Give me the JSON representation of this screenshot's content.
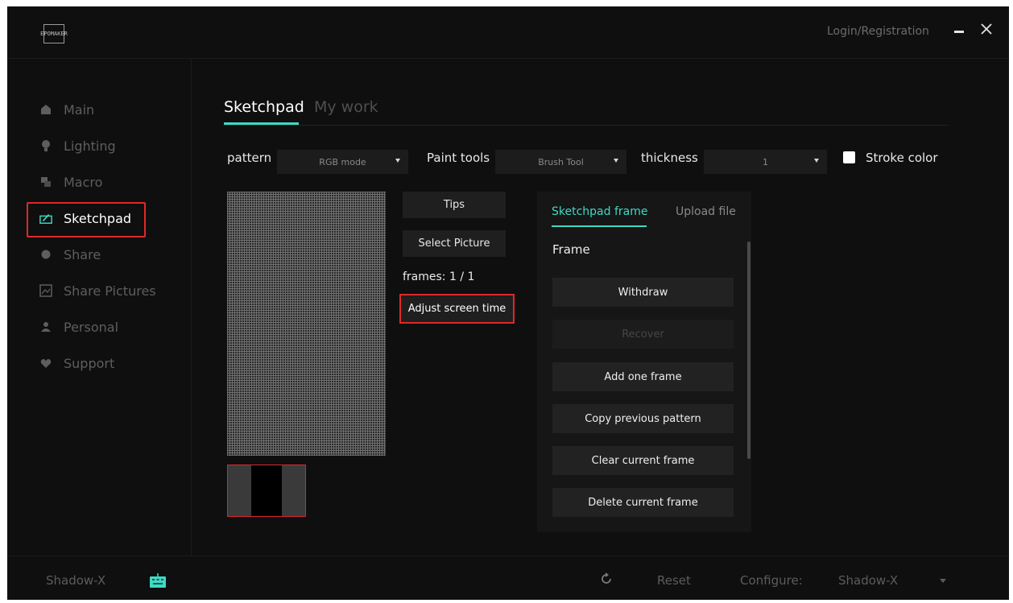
{
  "window": {
    "logo_text": "EPOMAKER",
    "login_label": "Login/Registration"
  },
  "sidebar": {
    "items": [
      {
        "label": "Main",
        "icon": "home-icon"
      },
      {
        "label": "Lighting",
        "icon": "bulb-icon"
      },
      {
        "label": "Macro",
        "icon": "macro-icon"
      },
      {
        "label": "Sketchpad",
        "icon": "sketchpad-icon",
        "active": true
      },
      {
        "label": "Share",
        "icon": "share-icon"
      },
      {
        "label": "Share Pictures",
        "icon": "picture-icon"
      },
      {
        "label": "Personal",
        "icon": "person-icon"
      },
      {
        "label": "Support",
        "icon": "heart-icon"
      }
    ]
  },
  "tabs": [
    {
      "label": "Sketchpad",
      "active": true
    },
    {
      "label": "My work",
      "active": false
    }
  ],
  "toolbar": {
    "pattern_label": "pattern",
    "pattern_value": "RGB mode",
    "paint_tools_label": "Paint tools",
    "paint_tools_value": "Brush Tool",
    "thickness_label": "thickness",
    "thickness_value": "1",
    "stroke_color_label": "Stroke color"
  },
  "actions": {
    "tips_label": "Tips",
    "select_picture_label": "Select Picture",
    "frames_text": "frames: 1 / 1",
    "adjust_label": "Adjust screen time"
  },
  "panel": {
    "tab_frame": "Sketchpad frame",
    "tab_upload": "Upload file",
    "frame_heading": "Frame",
    "buttons": [
      {
        "label": "Withdraw",
        "enabled": true
      },
      {
        "label": "Recover",
        "enabled": false
      },
      {
        "label": "Add one frame",
        "enabled": true
      },
      {
        "label": "Copy previous pattern",
        "enabled": true
      },
      {
        "label": "Clear current frame",
        "enabled": true
      },
      {
        "label": "Delete current frame",
        "enabled": true
      }
    ]
  },
  "footer": {
    "device_name": "Shadow-X",
    "reset_label": "Reset",
    "configure_label": "Configure:",
    "configure_value": "Shadow-X"
  },
  "colors": {
    "accent": "#3fd9c5",
    "highlight": "#e02828",
    "background": "#0f0f0f"
  }
}
